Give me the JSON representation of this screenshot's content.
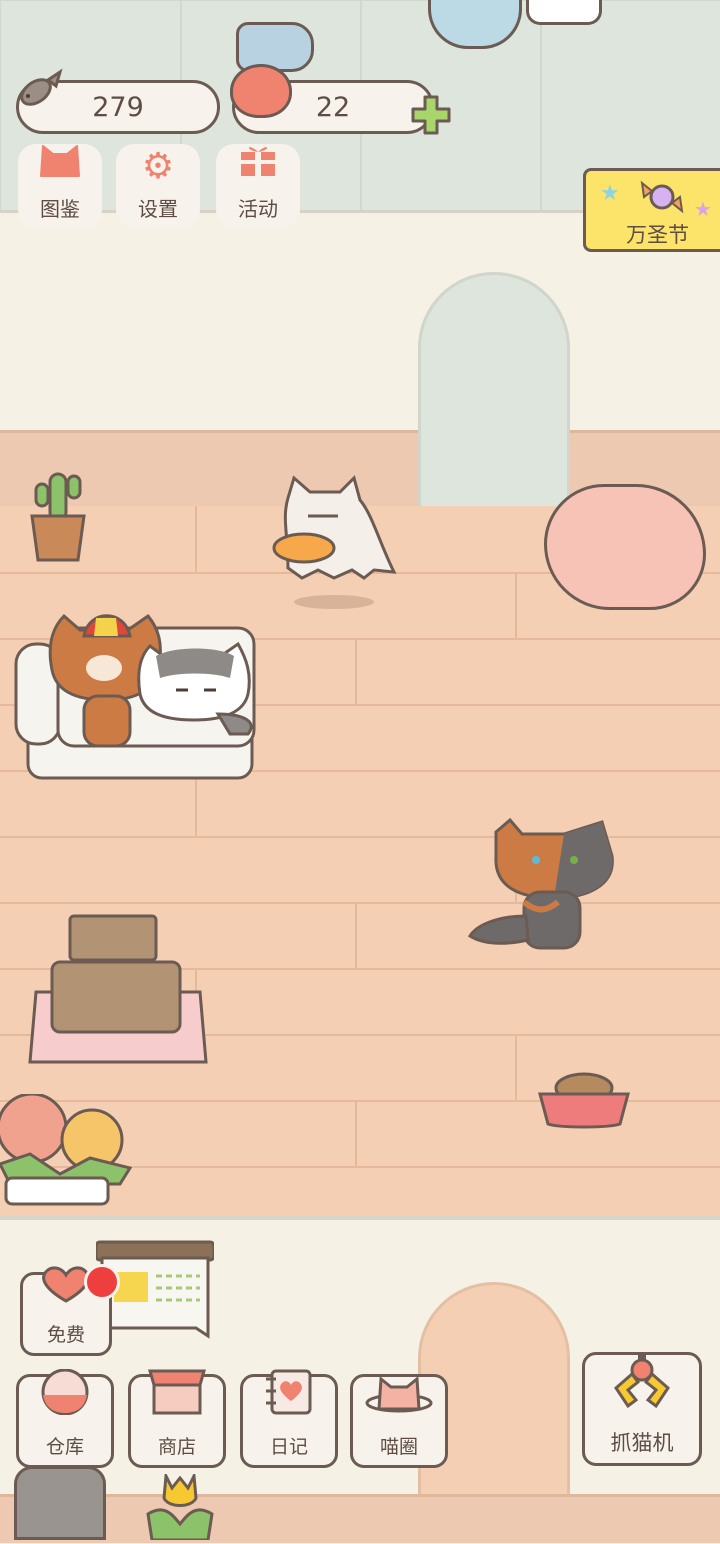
{
  "hud": {
    "fish_count": "279",
    "heart_count": "22",
    "plus_label": "+"
  },
  "top_menu": [
    {
      "label": "图鉴",
      "icon": "cat-head-icon"
    },
    {
      "label": "设置",
      "icon": "gear-icon"
    },
    {
      "label": "活动",
      "icon": "gift-icon"
    }
  ],
  "event_banner": {
    "label": "万圣节",
    "icon": "candy-icon"
  },
  "bottom_menu": {
    "free": {
      "label": "免费",
      "icon": "heart-icon",
      "has_notification": true
    },
    "items": [
      {
        "label": "仓库",
        "icon": "storage-icon"
      },
      {
        "label": "商店",
        "icon": "shop-icon"
      },
      {
        "label": "日记",
        "icon": "diary-icon"
      },
      {
        "label": "喵圈",
        "icon": "cat-planet-icon"
      }
    ],
    "claw": {
      "label": "抓猫机",
      "icon": "claw-machine-icon"
    }
  },
  "colors": {
    "accent": "#f08270",
    "outline": "#6b5b52",
    "panel": "#f7f3ec",
    "banner": "#fbe469",
    "floor": "#f4cfb3",
    "badge": "#ee3e3e",
    "plus": "#a8d66a"
  }
}
